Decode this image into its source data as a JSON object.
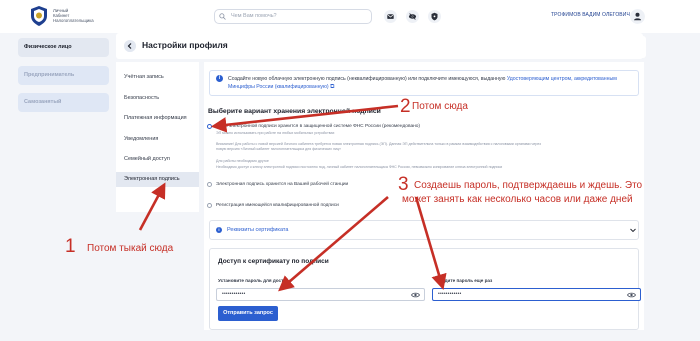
{
  "header": {
    "brand_lines": [
      "Личный",
      "Кабинет",
      "Налогоплательщика"
    ],
    "search_placeholder": "Чем Вам помочь?",
    "user_name": "ТРОФИМОВ ВАДИМ ОЛЕГОВИЧ",
    "icons": [
      "envelope-icon",
      "eye-off-icon",
      "shield-icon",
      "user-icon"
    ]
  },
  "left_menu": {
    "items": [
      {
        "label": "Физическое лицо",
        "state": "active"
      },
      {
        "label": "Предприниматель",
        "state": "inactive"
      },
      {
        "label": "Самозанятый",
        "state": "inactive"
      }
    ]
  },
  "page": {
    "title": "Настройки профиля"
  },
  "nav": {
    "items": [
      {
        "label": "Учётная запись"
      },
      {
        "label": "Безопасность"
      },
      {
        "label": "Платежная информация"
      },
      {
        "label": "Уведомления"
      },
      {
        "label": "Семейный доступ"
      },
      {
        "label": "Электронная подпись",
        "selected": true
      }
    ]
  },
  "info": {
    "text": "Создайте новую облачную электронную подпись (неквалифицированную) или подключите имеющуюся, выданную ",
    "link": "Удостоверяющим центром, аккредитованным Минцифры России (квалифицированную)"
  },
  "storage": {
    "title": "Выберите вариант хранения электронной подписи",
    "options": [
      {
        "label": "Ключ электронной подписи хранится в защищенной системе ФНС России (рекомендовано)",
        "selected": true,
        "notes": [
          "ЭП можно использовать при работе на любых мобильных устройствах",
          "Внимание! Для работы с новой версией Личного кабинета требуется новая электронная подпись (ЭП). Данная ЭП действительна только в рамках взаимодействия с налоговыми органами через новую версию «Личный кабинет налогоплательщика для физических лиц»",
          "Для работы необходимо другое",
          "Необходимо доступ к ключу электронной подписи постоянно под, личный кабинет налогоплательщика ФНС России, невозможно копирование ключа электронной подписи"
        ]
      },
      {
        "label": "Электронная подпись хранится на Вашей рабочей станции",
        "selected": false
      },
      {
        "label": "Регистрация имеющейся квалифицированной подписи",
        "selected": false
      }
    ]
  },
  "certificate": {
    "label": "Реквизиты сертификата"
  },
  "access": {
    "title": "Доступ к сертификату по подписи",
    "password_label": "Установите пароль для доступа",
    "confirm_label": "Введите пароль еще раз",
    "password_value": "••••••••••••",
    "confirm_value": "••••••••••••",
    "submit_label": "Отправить запрос"
  },
  "annotations": [
    {
      "number": "1",
      "text": "Потом тыкай сюда"
    },
    {
      "number": "2",
      "text": "Потом сюда"
    },
    {
      "number": "3",
      "text": "Создаешь пароль, подтверждаешь и ждешь. Это",
      "text2": "может занять как несколько часов или даже дней"
    }
  ],
  "colors": {
    "accent": "#2c5fd0",
    "annotation": "#c62f26",
    "background": "#f3f5f9"
  }
}
